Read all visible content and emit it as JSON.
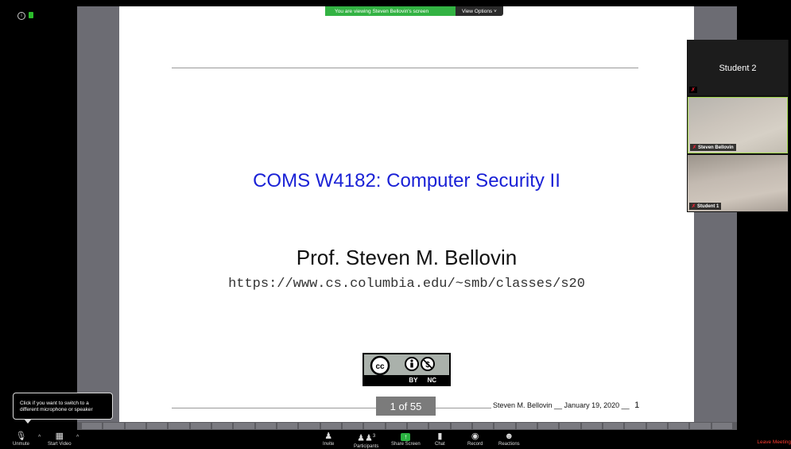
{
  "meeting": {
    "banner_text": "You are viewing Steven Bellovin's screen",
    "view_options_label": "View Options ˅"
  },
  "slide": {
    "title": "COMS W4182: Computer Security II",
    "author": "Prof. Steven M. Bellovin",
    "url": "https://www.cs.columbia.edu/~smb/classes/s20",
    "cc_labels": [
      "BY",
      "NC"
    ],
    "page_indicator": "1 of 55",
    "footer_text": "Steven M. Bellovin __ January 19, 2020 __",
    "footer_page": "1"
  },
  "participants": {
    "tiles": [
      {
        "name": "Student 2"
      },
      {
        "name": "Steven Bellovin"
      },
      {
        "name": "Student 1"
      }
    ]
  },
  "tooltip": {
    "text": "Click if you want to switch to a different microphone or speaker"
  },
  "toolbar": {
    "unmute_label": "Unmute",
    "start_video_label": "Start Video",
    "invite_label": "Invite",
    "participants_label": "Participants",
    "participants_count": "3",
    "share_label": "Share Screen",
    "chat_label": "Chat",
    "record_label": "Record",
    "reactions_label": "Reactions",
    "leave_label": "Leave Meeting"
  },
  "icons": {
    "mic": "mic-muted-icon",
    "video": "video-off-icon",
    "invite": "invite-icon",
    "participants": "participants-icon",
    "share": "share-screen-icon",
    "chat": "chat-icon",
    "record": "record-icon",
    "reactions": "reactions-icon"
  },
  "colors": {
    "banner_green": "#33b343",
    "slide_title_blue": "#1a21d6",
    "leave_red": "#ff3b30",
    "active_speaker_border": "#a3d84d"
  }
}
